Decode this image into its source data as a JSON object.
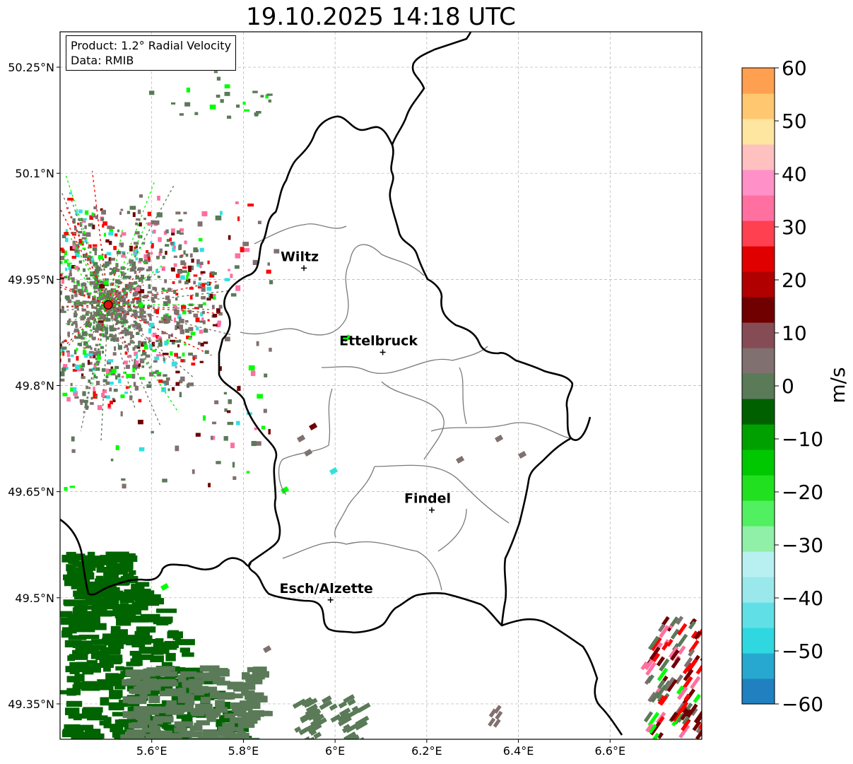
{
  "title": "19.10.2025 14:18 UTC",
  "product_box": {
    "product": "Product: 1.2° Radial Velocity",
    "data": "Data: RMIB"
  },
  "map": {
    "lon_range": [
      5.4,
      6.8
    ],
    "lat_range": [
      49.3,
      50.3
    ],
    "x_ticks": [
      "5.6°E",
      "5.8°E",
      "6°E",
      "6.2°E",
      "6.4°E",
      "6.6°E"
    ],
    "y_ticks": [
      "50.25°N",
      "50.1°N",
      "49.95°N",
      "49.8°N",
      "49.65°N",
      "49.5°N",
      "49.35°N"
    ],
    "grid": true,
    "radar_site": {
      "lon": 5.505,
      "lat": 49.914,
      "color": "#e01010"
    },
    "cities": [
      {
        "name": "Wiltz",
        "lon": 5.932,
        "lat": 49.966
      },
      {
        "name": "Ettelbruck",
        "lon": 6.104,
        "lat": 49.847
      },
      {
        "name": "Findel",
        "lon": 6.211,
        "lat": 49.624
      },
      {
        "name": "Esch/Alzette",
        "lon": 5.99,
        "lat": 49.497
      }
    ]
  },
  "colorbar": {
    "unit": "m/s",
    "range": [
      -60,
      60
    ],
    "ticks": [
      "60",
      "50",
      "40",
      "30",
      "20",
      "10",
      "0",
      "−10",
      "−20",
      "−30",
      "−40",
      "−50",
      "−60"
    ],
    "colors": [
      "#2080c0",
      "#26a8d0",
      "#2fd8e0",
      "#60e0e6",
      "#9ae8ec",
      "#b8f0f2",
      "#90f0a8",
      "#50f060",
      "#20e020",
      "#00c800",
      "#00a000",
      "#006000",
      "#5a7a58",
      "#80706f",
      "#864c55",
      "#700000",
      "#b00000",
      "#e00000",
      "#ff4050",
      "#ff70a0",
      "#ff90c8",
      "#ffc0c0",
      "#ffe6a0",
      "#ffc870",
      "#ffa050"
    ]
  },
  "palette": {
    "light_green": "#00ff00",
    "dark_green": "#006400",
    "muted_green": "#5a7a58",
    "grey_brown": "#80706f",
    "dark_red": "#6e0000",
    "red": "#ff0000",
    "pink": "#ff6fa0",
    "cyan": "#30e0e0"
  }
}
